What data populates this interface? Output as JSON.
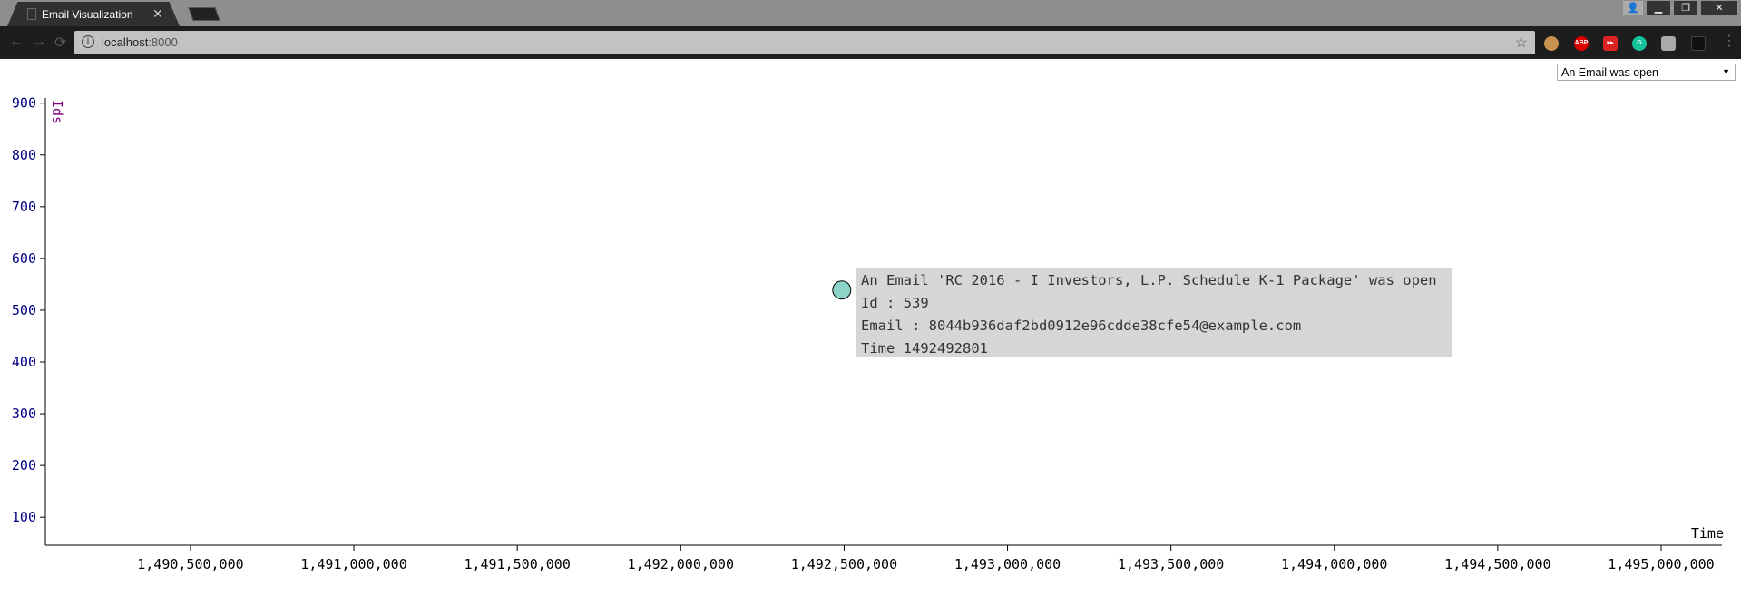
{
  "browser": {
    "tab_title": "Email Visualization",
    "url_host": "localhost",
    "url_port": ":8000"
  },
  "controls": {
    "event_select": "An Email was open"
  },
  "tooltip": {
    "title": "An Email 'RC 2016 - I Investors, L.P. Schedule K-1 Package' was open",
    "id": "Id : 539",
    "email": "Email : 8044b936daf2bd0912e96cdde38cfe54@example.com",
    "time": "Time 1492492801"
  },
  "chart_data": {
    "type": "scatter",
    "xlabel": "Time",
    "ylabel": "Ids",
    "xlim": [
      1490056000,
      1495186000
    ],
    "ylim": [
      46,
      910
    ],
    "xticks": [
      1490500000,
      1491000000,
      1491500000,
      1492000000,
      1492500000,
      1493000000,
      1493500000,
      1494000000,
      1494500000,
      1495000000
    ],
    "xtick_labels": [
      "1,490,500,000",
      "1,491,000,000",
      "1,491,500,000",
      "1,492,000,000",
      "1,492,500,000",
      "1,493,000,000",
      "1,493,500,000",
      "1,494,000,000",
      "1,494,500,000",
      "1,495,000,000"
    ],
    "yticks": [
      100,
      200,
      300,
      400,
      500,
      600,
      700,
      800,
      900
    ],
    "ytick_labels": [
      "100",
      "200",
      "300",
      "400",
      "500",
      "600",
      "700",
      "800",
      "900"
    ],
    "points": [
      {
        "x": 1492492801,
        "y": 539,
        "color": "#8dd3c7"
      }
    ]
  }
}
